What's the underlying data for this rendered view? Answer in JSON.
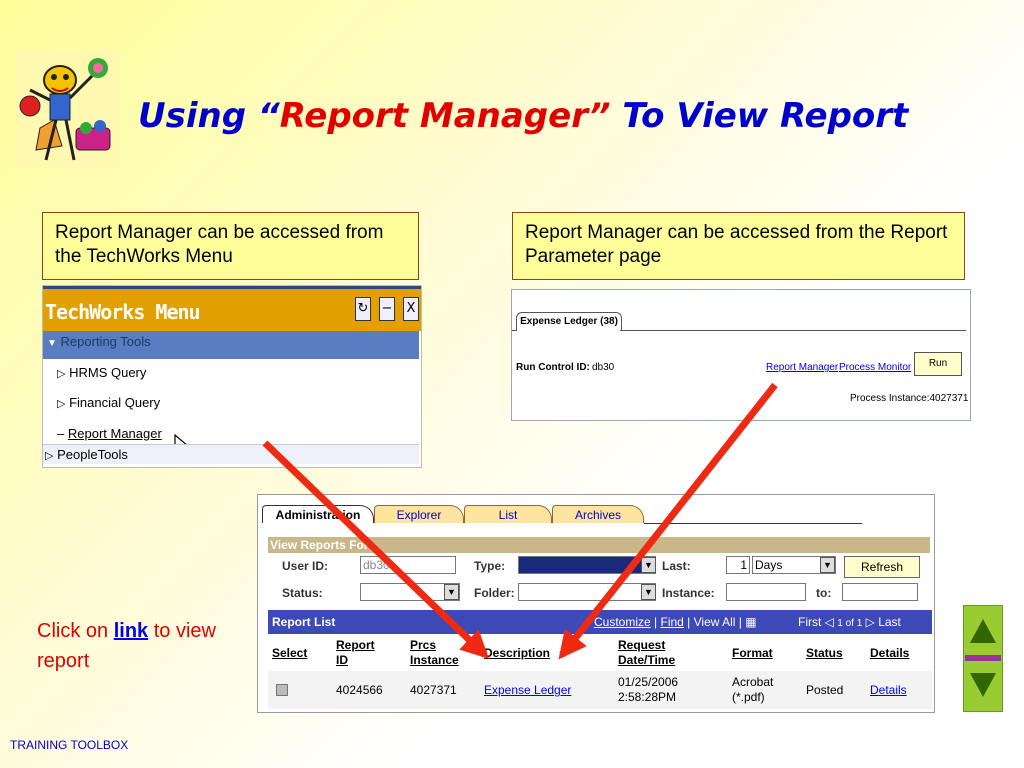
{
  "title": {
    "part1": "Using “",
    "highlight": "Report Manager”",
    "part2": " To View Report"
  },
  "callouts": {
    "left": "Report Manager can be accessed from the TechWorks Menu",
    "right": "Report Manager can be accessed from the Report Parameter page"
  },
  "techworks_menu": {
    "title": "TechWorks Menu",
    "buttons": [
      "↻",
      "−",
      "X"
    ],
    "reporting_tools": "Reporting Tools",
    "items": [
      "HRMS Query",
      "Financial Query",
      "Report Manager"
    ],
    "peopletools": "PeopleTools"
  },
  "report_parameter": {
    "tab": "Expense Ledger (38)",
    "run_control_label": "Run Control ID:",
    "run_control_value": "db30",
    "report_manager_link": "Report Manager",
    "process_monitor_link": "Process Monitor",
    "run_button": "Run",
    "process_instance": "Process Instance:4027371"
  },
  "report_manager": {
    "tabs": [
      "Administration",
      "Explorer",
      "List",
      "Archives"
    ],
    "view_reports_bar": "View Reports For",
    "fields": {
      "user_id_label": "User ID:",
      "user_id_value": "db30",
      "type_label": "Type:",
      "last_label": "Last:",
      "last_value": "1",
      "last_unit": "Days",
      "refresh": "Refresh",
      "status_label": "Status:",
      "folder_label": "Folder:",
      "instance_label": "Instance:",
      "to_label": "to:"
    },
    "report_list": {
      "title": "Report List",
      "customize": "Customize",
      "find": "Find",
      "view_all": "View All",
      "pager": "First",
      "pager_count": "1 of 1",
      "pager_last": "Last",
      "headers": {
        "select": "Select",
        "report_id": [
          "Report",
          "ID"
        ],
        "prcs_instance": [
          "Prcs",
          "Instance"
        ],
        "description": "Description",
        "request_datetime": [
          "Request",
          "Date/Time"
        ],
        "format": "Format",
        "status": "Status",
        "details": "Details"
      },
      "row": {
        "report_id": "4024566",
        "prcs_instance": "4027371",
        "description": "Expense Ledger",
        "date": "01/25/2006",
        "time": "2:58:28PM",
        "format1": "Acrobat",
        "format2": "(*.pdf)",
        "status": "Posted",
        "details": "Details"
      }
    }
  },
  "click_note": {
    "before": "Click on ",
    "link": "link",
    "after": " to view report"
  },
  "footer": "TRAINING TOOLBOX",
  "colors": {
    "title_blue": "#0000cc",
    "title_red": "#e00000",
    "arrow_red": "#ee2a12",
    "callout_fill": "#ffff99"
  }
}
